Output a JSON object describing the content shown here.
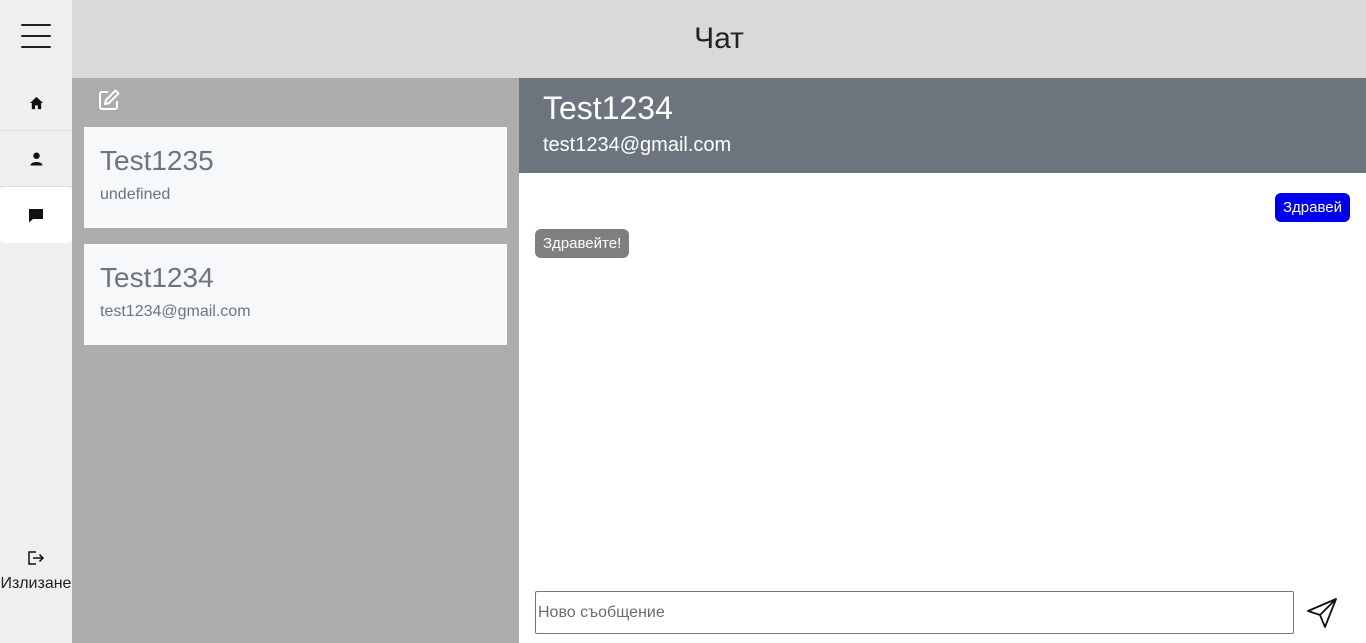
{
  "header": {
    "title": "Чат"
  },
  "sidebar": {
    "items": [
      {
        "icon": "home-icon"
      },
      {
        "icon": "user-icon"
      },
      {
        "icon": "chat-icon",
        "active": true
      }
    ],
    "logout_label": "Излизане"
  },
  "contacts": [
    {
      "name": "Test1235",
      "subtitle": "undefined"
    },
    {
      "name": "Test1234",
      "subtitle": "test1234@gmail.com"
    }
  ],
  "chat": {
    "name": "Test1234",
    "email": "test1234@gmail.com",
    "messages": [
      {
        "text": "Здравей",
        "direction": "outgoing"
      },
      {
        "text": "Здравейте!",
        "direction": "incoming"
      }
    ],
    "input_placeholder": "Ново съобщение"
  },
  "colors": {
    "sidebar_bg": "#efefef",
    "topbar_bg": "#d9d9d9",
    "contacts_bg": "#acacac",
    "chat_header_bg": "#6c757d",
    "outgoing_bubble": "#0000ee",
    "incoming_bubble": "#7f7f7f"
  }
}
